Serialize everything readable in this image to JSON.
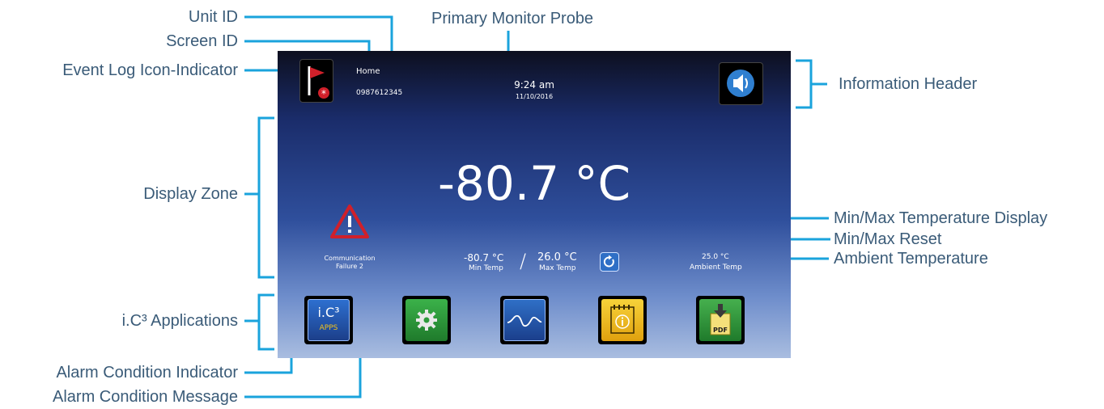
{
  "annotations": {
    "unit_id": "Unit ID",
    "screen_id": "Screen ID",
    "event_log": "Event Log Icon-Indicator",
    "display_zone": "Display Zone",
    "apps": "i.C³ Applications",
    "alarm_indicator": "Alarm Condition Indicator",
    "alarm_message": "Alarm Condition Message",
    "primary_probe": "Primary Monitor Probe",
    "info_header": "Information Header",
    "minmax_display": "Min/Max Temperature Display",
    "minmax_reset": "Min/Max Reset",
    "ambient": "Ambient Temperature"
  },
  "screen": {
    "screen_name": "Home",
    "unit_id": "0987612345",
    "time": "9:24 am",
    "date": "11/10/2016",
    "main_temp": "-80.7 °C",
    "alarm_line1": "Communication",
    "alarm_line2": "Failure 2",
    "min_value": "-80.7 °C",
    "min_label": "Min Temp",
    "separator": "/",
    "max_value": "26.0 °C",
    "max_label": "Max Temp",
    "ambient_value": "25.0 °C",
    "ambient_label": "Ambient Temp",
    "apps_logo": "i.C³",
    "apps_label": "APPS",
    "pdf_label": "PDF"
  },
  "colors": {
    "callout_line": "#1aa3dc",
    "annotation_text": "#3a5b78",
    "alarm_red": "#d0202a",
    "settings_green": "#2e9a3c",
    "notes_yellow": "#f2c21c"
  },
  "icons": [
    "flag-icon",
    "speaker-icon",
    "alarm-triangle-icon",
    "reset-icon",
    "apps-icon",
    "settings-gear-icon",
    "graph-icon",
    "notes-icon",
    "pdf-download-icon"
  ]
}
